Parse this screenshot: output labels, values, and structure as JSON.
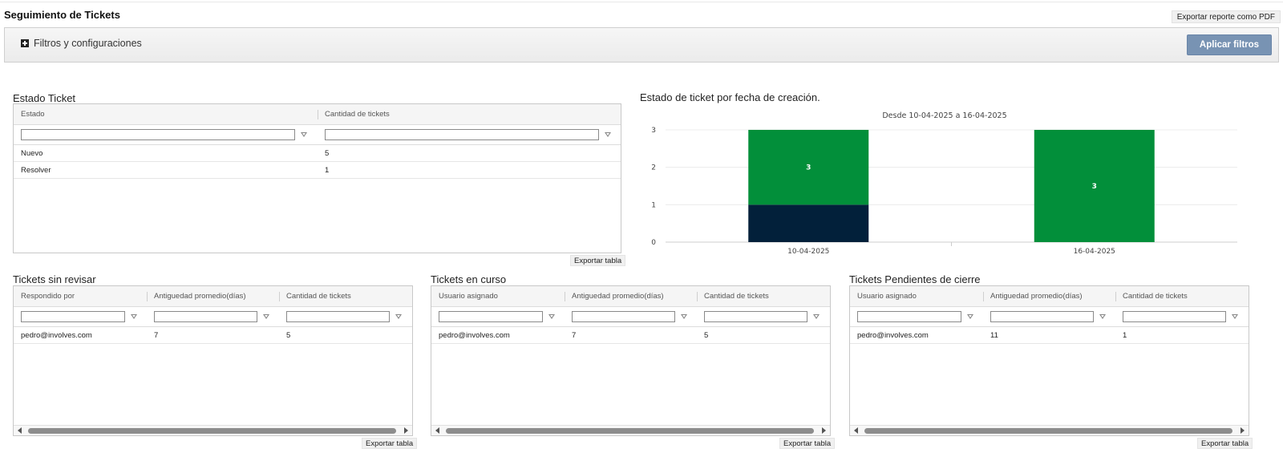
{
  "page": {
    "title": "Seguimiento de Tickets",
    "export_pdf_label": "Exportar reporte como PDF"
  },
  "filters": {
    "toggle_label": "Filtros y configuraciones",
    "apply_label": "Aplicar filtros"
  },
  "estado_ticket": {
    "title": "Estado Ticket",
    "columns": [
      "Estado",
      "Cantidad de tickets"
    ],
    "rows": [
      [
        "Nuevo",
        "5"
      ],
      [
        "Resolver",
        "1"
      ]
    ],
    "export_label": "Exportar tabla"
  },
  "chart_section": {
    "title": "Estado de ticket por fecha de creación."
  },
  "chart_data": {
    "type": "bar",
    "stacked": true,
    "title": "Desde 10-04-2025 a 16-04-2025",
    "categories": [
      "10-04-2025",
      "16-04-2025"
    ],
    "series": [
      {
        "values": [
          1,
          0
        ],
        "color": "#02203a"
      },
      {
        "values": [
          2,
          3
        ],
        "color": "#028f3a"
      }
    ],
    "total_labels": [
      "3",
      "3"
    ],
    "ylim": [
      0,
      3
    ],
    "yticks": [
      "0",
      "1",
      "2",
      "3"
    ],
    "grid": true
  },
  "sin_revisar": {
    "title": "Tickets sin revisar",
    "columns": [
      "Respondido por",
      "Antiguedad promedio(días)",
      "Cantidad de tickets"
    ],
    "rows": [
      [
        "pedro@involves.com",
        "7",
        "5"
      ]
    ],
    "export_label": "Exportar tabla"
  },
  "en_curso": {
    "title": "Tickets en curso",
    "columns": [
      "Usuario asignado",
      "Antiguedad promedio(días)",
      "Cantidad de tickets"
    ],
    "rows": [
      [
        "pedro@involves.com",
        "7",
        "5"
      ]
    ],
    "export_label": "Exportar tabla"
  },
  "pendientes": {
    "title": "Tickets Pendientes de cierre",
    "columns": [
      "Usuario asignado",
      "Antiguedad promedio(días)",
      "Cantidad de tickets"
    ],
    "rows": [
      [
        "pedro@involves.com",
        "11",
        "1"
      ]
    ],
    "export_label": "Exportar tabla"
  }
}
